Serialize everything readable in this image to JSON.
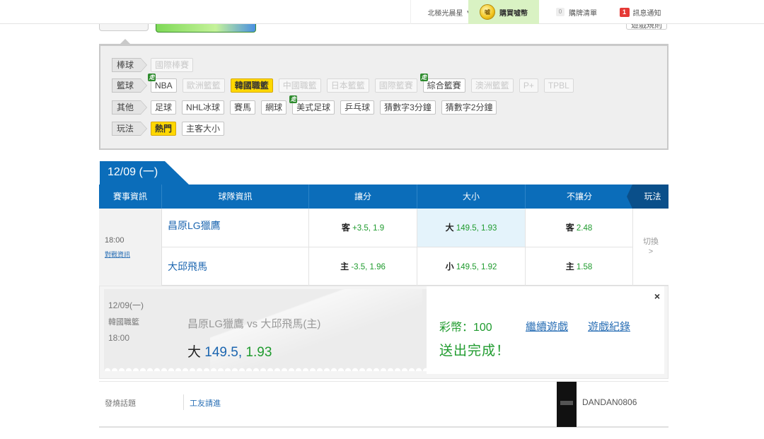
{
  "topbar": {
    "region": "北極光晨星",
    "buy_coins": "購買噓幣",
    "coin_icon_text": "噓",
    "cart_count": "0",
    "cart": "購牌清單",
    "msg_count": "1",
    "messages": "訊息通知"
  },
  "under": {
    "rules": "遊戲規則"
  },
  "filters": {
    "baseball": {
      "cat": "棒球",
      "tags": [
        "國際棒賽"
      ]
    },
    "basketball": {
      "cat": "籃球",
      "tags": [
        "NBA",
        "歐洲籃籃",
        "韓國職籃",
        "中國職籃",
        "日本籃籃",
        "國際籃賽",
        "綜合籃賽",
        "澳洲籃籃",
        "P+",
        "TPBL"
      ]
    },
    "other": {
      "cat": "其他",
      "tags": [
        "足球",
        "NHL冰球",
        "賽馬",
        "網球",
        "美式足球",
        "乒乓球",
        "猜數字3分鐘",
        "猜數字2分鐘"
      ]
    },
    "play": {
      "cat": "玩法",
      "tags": [
        "熱門",
        "主客大小"
      ]
    },
    "live_badge": "走"
  },
  "date_tab": "12/09 (一)",
  "table": {
    "headers": [
      "賽事資訊",
      "球隊資訊",
      "讓分",
      "大小",
      "不讓分"
    ],
    "play_tab": "玩法",
    "time": "18:00",
    "matchup_link": "對戰資訊",
    "team1": "昌原LG獵鷹",
    "team2": "大邱飛馬",
    "spread1": {
      "side": "客",
      "value": "+3.5, 1.9"
    },
    "spread2": {
      "side": "主",
      "value": "-3.5, 1.96"
    },
    "total1": {
      "side": "大",
      "value": "149.5, 1.93"
    },
    "total2": {
      "side": "小",
      "value": "149.5, 1.92"
    },
    "ml1": {
      "side": "客",
      "value": "2.48"
    },
    "ml2": {
      "side": "主",
      "value": "1.58"
    },
    "switch": "切換",
    "switch_arrow": ">"
  },
  "receipt": {
    "date": "12/09(一)",
    "league": "韓國職籃",
    "time": "18:00",
    "match": "昌原LG獵鷹  vs  大邱飛馬(主)",
    "pick_side": "大",
    "pick_line": "149.5,",
    "pick_odds": "1.93",
    "coins": "彩幣：100",
    "done": "送出完成！",
    "continue": "繼續遊戲",
    "history": "遊戲紀錄",
    "close": "×"
  },
  "discussion": {
    "label": "發燒話題",
    "title": "工友請進",
    "user": "DANDAN0806"
  },
  "colors": {
    "primary_blue": "#0b6dba",
    "accent_yellow": "#ffd800",
    "odds_green": "#1f9b2e",
    "link_blue": "#2a6fb5"
  }
}
